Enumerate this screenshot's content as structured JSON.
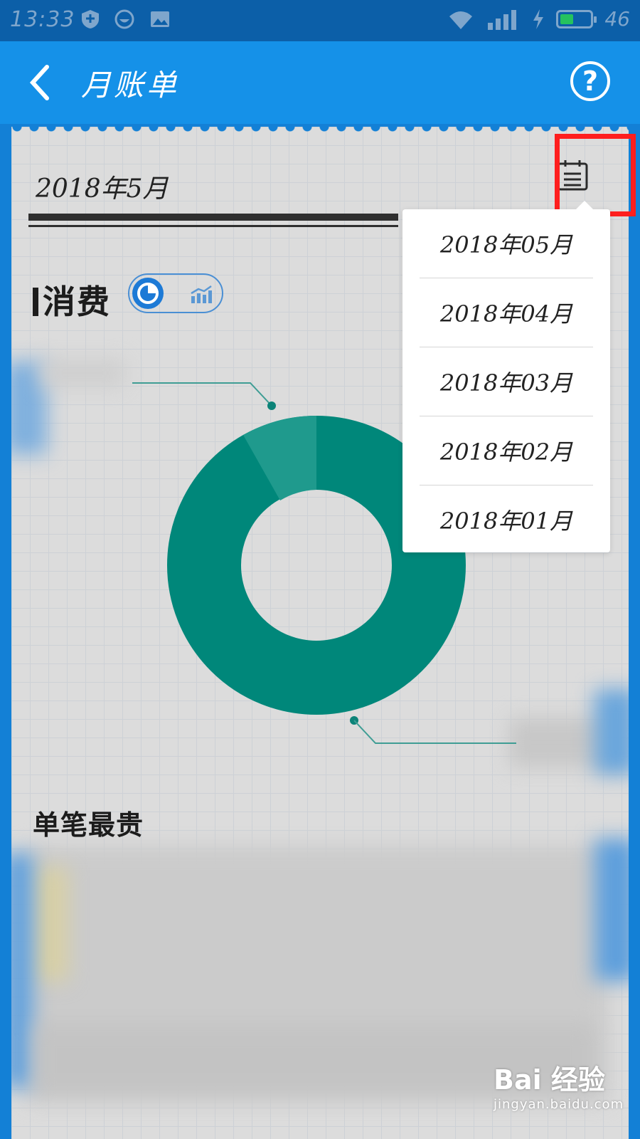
{
  "status_bar": {
    "time": "13:33",
    "battery_level": "46",
    "battery_fill_fraction": 0.46
  },
  "app_bar": {
    "title": "月账单"
  },
  "bill": {
    "current_month": "2018年5月",
    "section_consumption": "消费",
    "section_top_single": "单笔最贵"
  },
  "month_dropdown": {
    "items": [
      "2018年05月",
      "2018年04月",
      "2018年03月",
      "2018年02月",
      "2018年01月"
    ]
  },
  "watermark": {
    "brand": "Bai 经验",
    "url": "jingyan.baidu.com"
  },
  "colors": {
    "accent": "#1591e8",
    "donut": "#00877a",
    "donut_light": "#1f9a8d",
    "highlight": "#ff1e1e"
  }
}
